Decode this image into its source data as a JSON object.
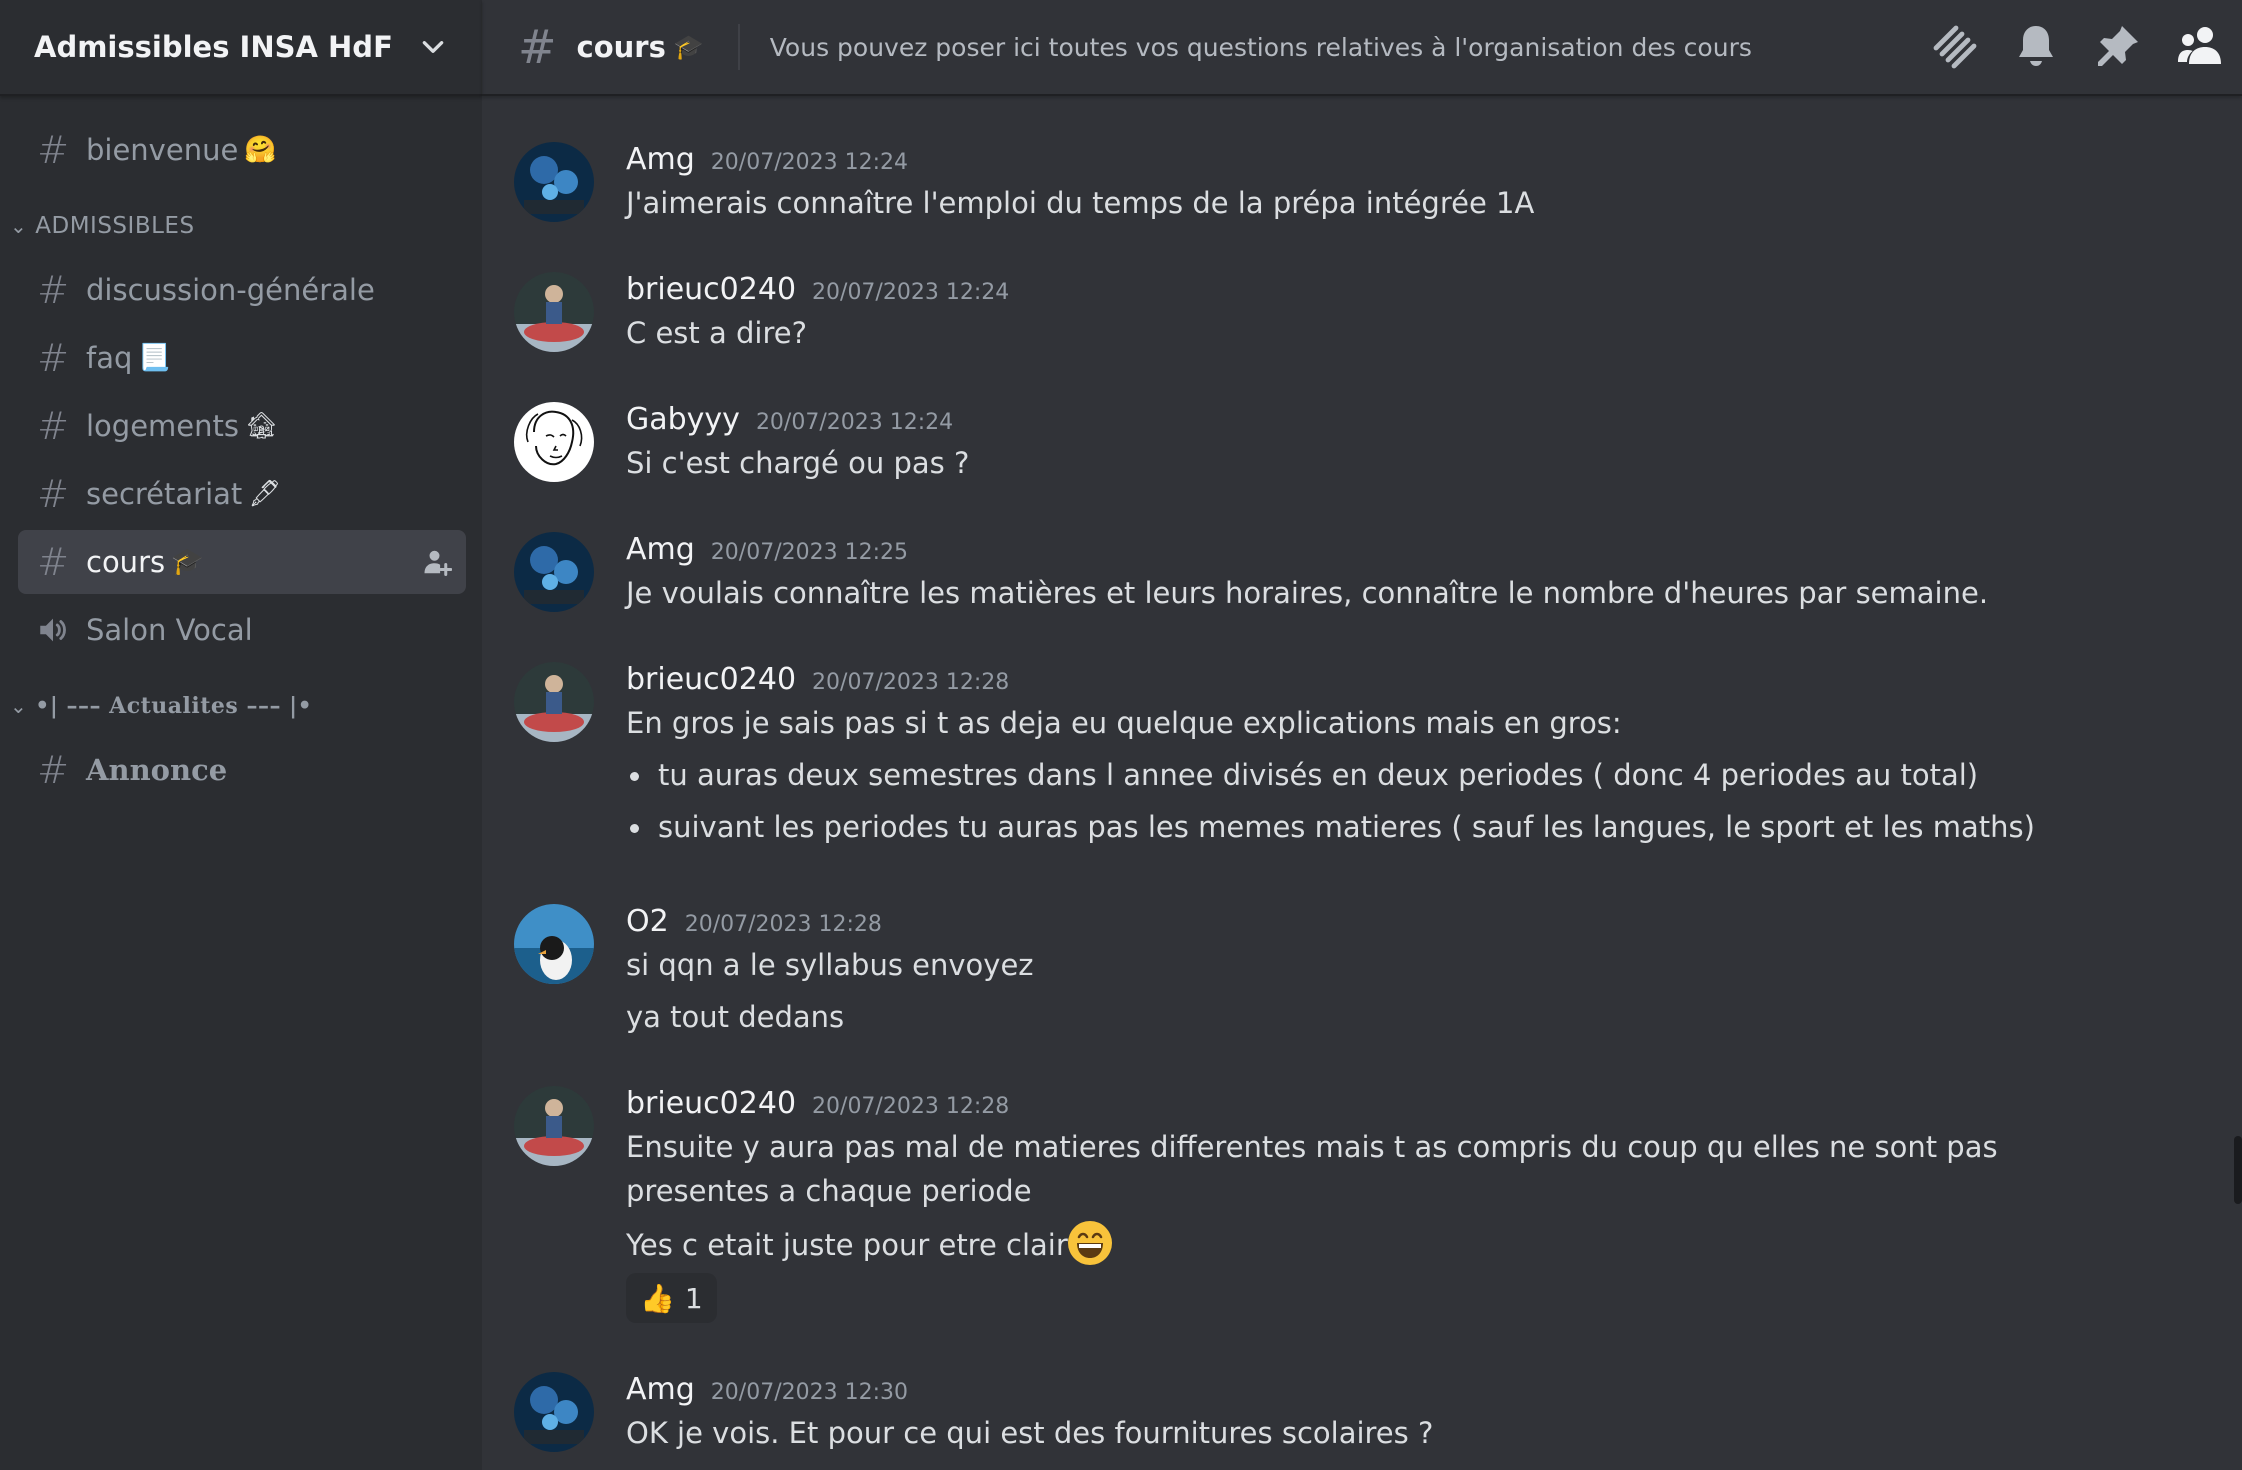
{
  "server": {
    "name": "Admissibles INSA HdF"
  },
  "sidebar": {
    "top_channels": [
      {
        "name": "bienvenue",
        "emoji": "🤗"
      }
    ],
    "categories": [
      {
        "label": "ADMISSIBLES",
        "channels": [
          {
            "name": "discussion-générale",
            "emoji": ""
          },
          {
            "name": "faq",
            "emoji": "📃"
          },
          {
            "name": "logements",
            "emoji": "🏚"
          },
          {
            "name": "secrétariat",
            "emoji": "🖋"
          },
          {
            "name": "cours",
            "emoji": "🎓"
          },
          {
            "name": "Salon Vocal",
            "emoji": ""
          }
        ]
      },
      {
        "label": "•| ––– Actualites ––– |•",
        "channels": [
          {
            "name": "Annonce",
            "emoji": ""
          }
        ]
      }
    ],
    "active_channel": "cours"
  },
  "topbar": {
    "channel_name": "cours",
    "channel_emoji": "🎓",
    "topic": "Vous pouvez poser ici toutes vos questions relatives à l'organisation des cours",
    "icons": [
      "threads-icon",
      "bell-icon",
      "pin-icon",
      "members-icon"
    ]
  },
  "messages": [
    {
      "author": "Amg",
      "timestamp": "20/07/2023 12:24",
      "lines": [
        "J'aimerais connaître l'emploi du temps de la prépa intégrée 1A"
      ]
    },
    {
      "author": "brieuc0240",
      "timestamp": "20/07/2023 12:24",
      "lines": [
        "C est a dire?"
      ]
    },
    {
      "author": "Gabyyy",
      "timestamp": "20/07/2023 12:24",
      "lines": [
        "Si c'est chargé ou pas ?"
      ]
    },
    {
      "author": "Amg",
      "timestamp": "20/07/2023 12:25",
      "lines": [
        "Je voulais connaître les matières et leurs horaires, connaître le nombre d'heures par semaine."
      ]
    },
    {
      "author": "brieuc0240",
      "timestamp": "20/07/2023 12:28",
      "lines": [
        "En gros je sais pas si t as deja eu quelque explications mais en gros:"
      ],
      "bullets": [
        "tu auras deux semestres dans l annee divisés en deux periodes ( donc 4 periodes au total)",
        "suivant les periodes tu auras pas les memes matieres ( sauf les langues, le sport et les maths)"
      ]
    },
    {
      "author": "O2",
      "timestamp": "20/07/2023 12:28",
      "lines": [
        "si qqn a le syllabus envoyez",
        "ya tout dedans"
      ]
    },
    {
      "author": "brieuc0240",
      "timestamp": "20/07/2023 12:28",
      "lines": [
        "Ensuite y aura pas mal de matieres differentes mais t as compris du coup qu elles ne sont pas presentes a chaque periode",
        "Yes c etait juste pour etre clair"
      ],
      "reaction": {
        "emoji": "👍",
        "count": "1"
      }
    },
    {
      "author": "Amg",
      "timestamp": "20/07/2023 12:30",
      "lines": [
        "OK je vois. Et pour ce qui est des fournitures scolaires ?"
      ]
    }
  ]
}
